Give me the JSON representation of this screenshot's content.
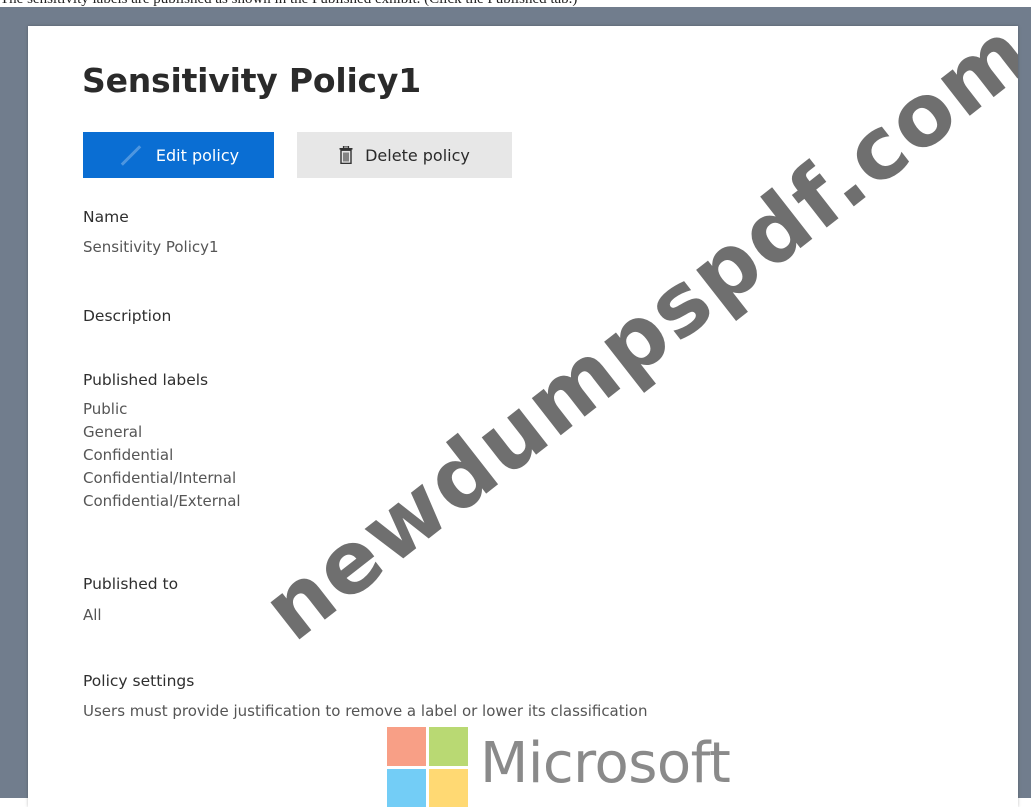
{
  "caption": "The sensitivity labels are published as shown in the Published exhibit. (Click the Published tab.)",
  "page": {
    "title": "Sensitivity Policy1"
  },
  "toolbar": {
    "edit_label": "Edit policy",
    "delete_label": "Delete policy"
  },
  "details": {
    "name": {
      "label": "Name",
      "value": "Sensitivity Policy1"
    },
    "description": {
      "label": "Description"
    },
    "published_labels": {
      "label": "Published labels",
      "items": [
        "Public",
        "General",
        "Confidential",
        "Confidential/Internal",
        "Confidential/External"
      ]
    },
    "published_to": {
      "label": "Published to",
      "value": "All"
    },
    "policy_settings": {
      "label": "Policy settings",
      "value": "Users must provide justification to remove a label or lower its classification"
    }
  },
  "watermark": "newdumpspdf.com",
  "logo": {
    "text": "Microsoft",
    "colors": [
      "#f25022",
      "#7fba00",
      "#00a4ef",
      "#ffb900"
    ]
  },
  "icons": {
    "edit": "pencil-icon",
    "delete": "trash-icon"
  },
  "colors": {
    "primary_button": "#0a6ed3",
    "secondary_button": "#e7e7e7",
    "frame": "#717d8d"
  }
}
